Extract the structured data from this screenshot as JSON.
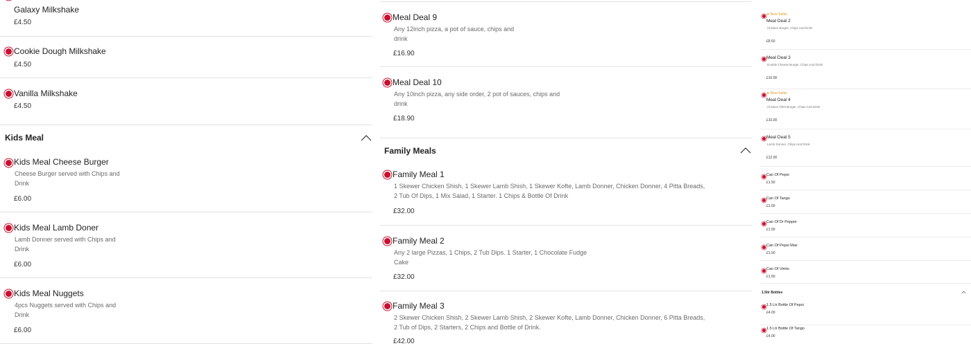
{
  "col1": {
    "items_top": [
      {
        "name": "Galaxy Milkshake",
        "price": "£4.50"
      },
      {
        "name": "Cookie Dough Milkshake",
        "price": "£4.50"
      },
      {
        "name": "Vanilla Milkshake",
        "price": "£4.50"
      }
    ],
    "kids_section": {
      "title": "Kids Meal"
    },
    "kids_items": [
      {
        "name": "Kids Meal Cheese Burger",
        "desc": "Cheese Burger served with Chips and Drink",
        "price": "£6.00"
      },
      {
        "name": "Kids Meal Lamb Doner",
        "desc": "Lamb Donner served with Chips and Drink",
        "price": "£6.00"
      },
      {
        "name": "Kids Meal Nuggets",
        "desc": "4pcs Nuggets served with Chips and Drink",
        "price": "£6.00"
      }
    ]
  },
  "col2": {
    "meal_deals": [
      {
        "name": "Meal Deal 9",
        "desc": "Any 12inch pizza, a pot of sauce, chips and drink",
        "price": "£16.90"
      },
      {
        "name": "Meal Deal 10",
        "desc": "Any 10inch pizza, any side order, 2 pot of sauces, chips and drink",
        "price": "£18.90"
      }
    ],
    "family_section": {
      "title": "Family Meals"
    },
    "family_meals": [
      {
        "name": "Family Meal 1",
        "desc": "1 Skewer Chicken Shish, 1 Skewer Lamb Shish, 1 Skewer Kofte, Lamb Donner, Chicken Donner, 4 Pitta Breads, 2 Tub Of Dips, 1 Mix Salad, 1 Starter. 1 Chips & Bottle Of Drink",
        "price": "£32.00"
      },
      {
        "name": "Family Meal 2",
        "desc": "Any 2 large Pizzas, 1 Chips, 2 Tub Dips. 1 Starter, 1 Chocolate Fudge Cake",
        "price": "£32.00"
      },
      {
        "name": "Family Meal 3",
        "desc": "2 Skewer Chicken Shish, 2 Skewer Lamb Shish, 2 Skewer Kofte, Lamb Donner, Chicken Donner, 6 Pitta Breads, 2 Tub of Dips, 2 Starters, 2 Chips and Bottle of Drink.",
        "price": "£42.00"
      }
    ]
  },
  "col3": {
    "badge_text": "Best Seller",
    "items": [
      {
        "name": "Meal Deal 2",
        "desc": "Chicken Burger, Chips And Drink",
        "price": "£8.50",
        "best": true
      },
      {
        "name": "Meal Deal 3",
        "desc": "Double Cheese Burger, Chips And Drink",
        "price": "£10.00",
        "best": false
      },
      {
        "name": "Meal Deal 4",
        "desc": "Chicken Fillet Burger, Chips And Drink",
        "price": "£10.00",
        "best": true
      },
      {
        "name": "Meal Deal 5",
        "desc": "Lamb Donner, Chips And Drink",
        "price": "£12.00",
        "best": false
      },
      {
        "name": "Can Of Pepsi",
        "desc": "",
        "price": "£1.50",
        "best": false,
        "veg": true
      },
      {
        "name": "Can Of Tango",
        "desc": "",
        "price": "£1.50",
        "best": false,
        "veg": true
      },
      {
        "name": "Can Of Dr Pepper",
        "desc": "",
        "price": "£1.50",
        "best": false,
        "veg": true
      },
      {
        "name": "Can Of Pepsi Max",
        "desc": "",
        "price": "£1.50",
        "best": false,
        "veg": true
      },
      {
        "name": "Can Of Vimto",
        "desc": "",
        "price": "£1.50",
        "best": false,
        "veg": true
      }
    ],
    "bottles_section": {
      "title": "1.5ltr Bottles"
    },
    "bottles": [
      {
        "name": "1.5 Ltr Bottle Of Pepsi",
        "price": "£4.00"
      },
      {
        "name": "1.5 Ltr Bottle Of Tango",
        "price": "£4.00"
      }
    ]
  },
  "colors": {
    "accent": "#c8102e",
    "veg": "#1f8f2e",
    "badge": "#e29b1c"
  }
}
